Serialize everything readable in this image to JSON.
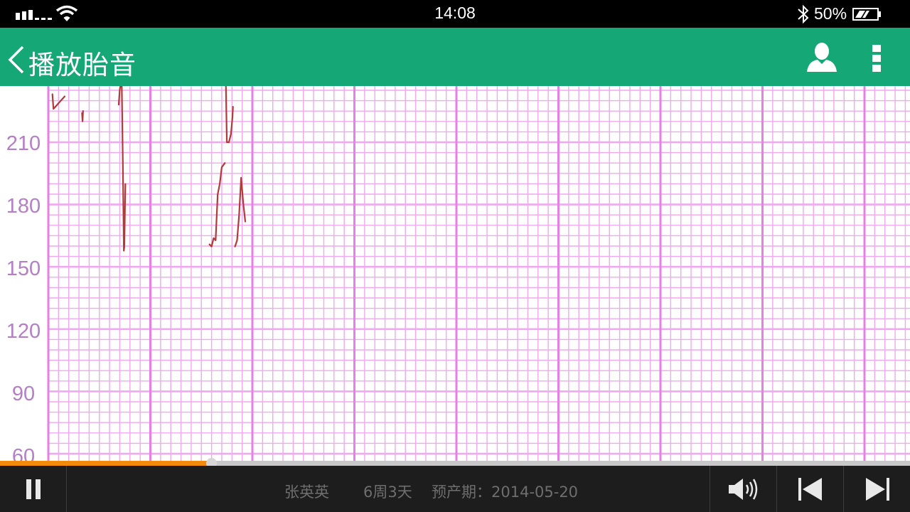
{
  "status_bar": {
    "time": "14:08",
    "battery_pct": "50%",
    "icons": [
      "signal-icon",
      "wifi-icon",
      "bluetooth-icon",
      "battery-icon"
    ]
  },
  "app_bar": {
    "title": "播放胎音",
    "icons": [
      "back-arrow-icon",
      "user-icon",
      "more-vertical-icon"
    ],
    "color": "#16a777"
  },
  "chart_data": {
    "type": "line",
    "yticks": [
      "210",
      "180",
      "150",
      "120",
      "90",
      "60"
    ],
    "ylim": [
      60,
      240
    ],
    "grid": true,
    "grid_color": "#f0a8f0",
    "line_color": "#b33a3a",
    "segments": [
      {
        "x": [
          0.4,
          0.5,
          1.6
        ],
        "y": [
          233,
          226,
          232
        ]
      },
      {
        "x": [
          3.3,
          3.35,
          3.4
        ],
        "y": [
          224,
          220,
          225
        ]
      },
      {
        "x": [
          6.9,
          7.0,
          7.1,
          7.2,
          7.3,
          7.4,
          7.45,
          7.55
        ],
        "y": [
          228,
          235,
          238,
          237,
          200,
          158,
          160,
          190
        ]
      },
      {
        "x": [
          15.8,
          16.0,
          16.2,
          16.4,
          16.6,
          16.8,
          17.0,
          17.3
        ],
        "y": [
          161,
          160,
          164,
          163,
          185,
          190,
          198,
          200
        ]
      },
      {
        "x": [
          17.4,
          17.5,
          17.7,
          17.9,
          18.05,
          18.1
        ],
        "y": [
          238,
          210,
          210,
          214,
          222,
          227
        ]
      },
      {
        "x": [
          18.3,
          18.5,
          18.7,
          18.9,
          19.1,
          19.3
        ],
        "y": [
          160,
          163,
          175,
          193,
          181,
          172
        ]
      }
    ]
  },
  "playback": {
    "progress": 0.232,
    "progress_color": "#f38a0c",
    "patient_name": "张英英",
    "gestation": "6周3天",
    "due_date": "预产期：2014-05-20",
    "icons": [
      "pause-icon",
      "volume-icon",
      "previous-icon",
      "next-icon"
    ]
  }
}
